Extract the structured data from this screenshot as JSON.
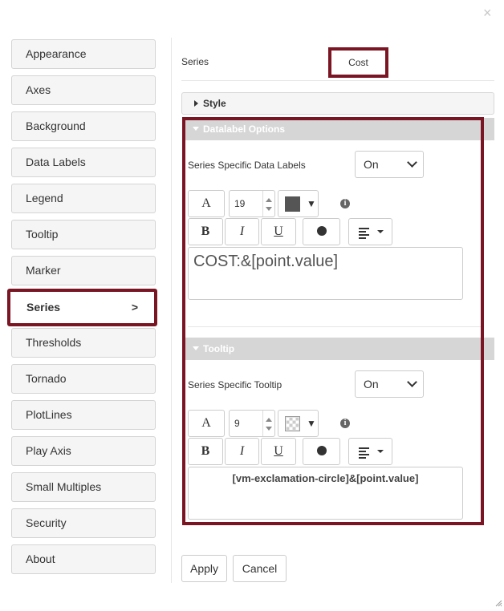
{
  "close_glyph": "×",
  "sidebar": {
    "items": [
      {
        "label": "Appearance"
      },
      {
        "label": "Axes"
      },
      {
        "label": "Background"
      },
      {
        "label": "Data Labels"
      },
      {
        "label": "Legend"
      },
      {
        "label": "Tooltip"
      },
      {
        "label": "Marker"
      },
      {
        "label": "Series",
        "chevron": ">"
      },
      {
        "label": "Thresholds"
      },
      {
        "label": "Tornado"
      },
      {
        "label": "PlotLines"
      },
      {
        "label": "Play Axis"
      },
      {
        "label": "Small Multiples"
      },
      {
        "label": "Security"
      },
      {
        "label": "About"
      }
    ],
    "active": "Series"
  },
  "series": {
    "label": "Series",
    "value": "Cost"
  },
  "style_section": {
    "title": "Style"
  },
  "datalabel": {
    "title": "Datalabel Options",
    "toggle_label": "Series Specific Data Labels",
    "toggle_value": "On",
    "font_glyph": "A",
    "font_size": "19",
    "color": "#555555",
    "bold": "B",
    "italic": "I",
    "underline": "U",
    "info": "i",
    "text": "COST:&[point.value]"
  },
  "tooltip": {
    "title": "Tooltip",
    "toggle_label": "Series Specific Tooltip",
    "toggle_value": "On",
    "font_glyph": "A",
    "font_size": "9",
    "color": "transparent-checker",
    "bold": "B",
    "italic": "I",
    "underline": "U",
    "info": "i",
    "text": "[vm-exclamation-circle]&[point.value]"
  },
  "footer": {
    "apply": "Apply",
    "cancel": "Cancel"
  },
  "colors": {
    "accent": "#7a1523",
    "section_bar": "#d6d6d6"
  }
}
